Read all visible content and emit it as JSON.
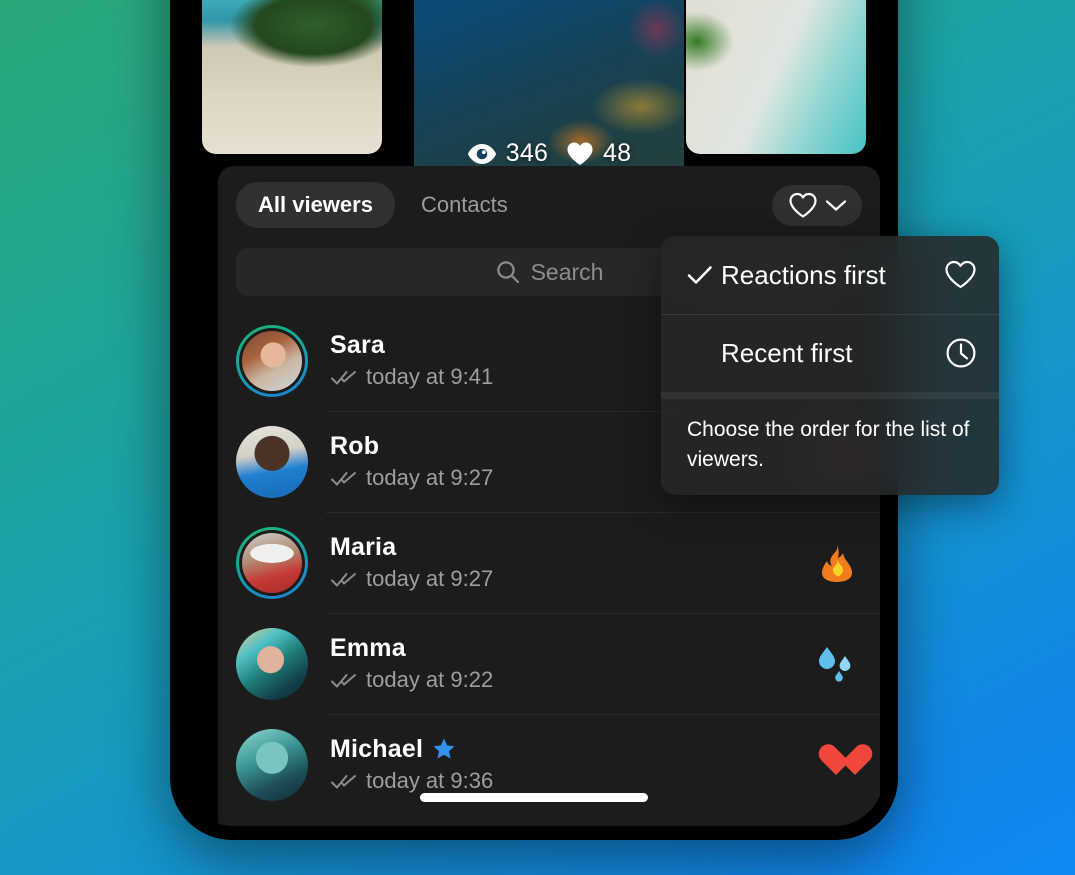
{
  "story": {
    "stats": [
      {
        "icon": "eye-icon",
        "label": "views",
        "value": "346"
      },
      {
        "icon": "heart-filled-icon",
        "label": "reactions",
        "value": "48"
      }
    ],
    "thumbnails": [
      {
        "name": "thumbnail-beach",
        "alt": "beach with palm tree"
      },
      {
        "name": "thumbnail-reef",
        "alt": "coral reef with diver"
      },
      {
        "name": "thumbnail-aerial",
        "alt": "aerial beach view"
      }
    ]
  },
  "panel": {
    "tabs": [
      {
        "label": "All viewers",
        "active": true
      },
      {
        "label": "Contacts",
        "active": false
      }
    ],
    "sort_button": {
      "icon": "heart-outline-icon",
      "chevron": "chevron-down-icon"
    },
    "search": {
      "placeholder": "Search",
      "value": "",
      "icon": "search-icon"
    },
    "viewers": [
      {
        "name": "Sara",
        "time": "today at 9:41",
        "status_icon": "double-check-icon",
        "reaction": "",
        "premium": false,
        "has_story_ring": true,
        "avatar": "av-sara"
      },
      {
        "name": "Rob",
        "time": "today at 9:27",
        "status_icon": "double-check-icon",
        "reaction": "heart",
        "premium": false,
        "has_story_ring": false,
        "avatar": "av-rob"
      },
      {
        "name": "Maria",
        "time": "today at 9:27",
        "status_icon": "double-check-icon",
        "reaction": "fire",
        "premium": false,
        "has_story_ring": true,
        "avatar": "av-maria"
      },
      {
        "name": "Emma",
        "time": "today at 9:22",
        "status_icon": "double-check-icon",
        "reaction": "droplets",
        "premium": false,
        "has_story_ring": false,
        "avatar": "av-emma"
      },
      {
        "name": "Michael",
        "time": "today at 9:36",
        "status_icon": "double-check-icon",
        "reaction": "heart",
        "premium": true,
        "has_story_ring": false,
        "avatar": "av-michael"
      }
    ]
  },
  "sort_menu": {
    "items": [
      {
        "label": "Reactions first",
        "checked": true,
        "icon": "heart-outline-icon"
      },
      {
        "label": "Recent first",
        "checked": false,
        "icon": "clock-icon"
      }
    ],
    "footer": "Choose the order for the list of viewers."
  },
  "colors": {
    "background_start": "#2aa87a",
    "background_end": "#0e88f5",
    "panel": "#1c1c1c",
    "accent_active_tab": "#303030",
    "heart_red": "#f0463c",
    "premium_star": "#3390ec",
    "story_ring_start": "#1fb36e",
    "story_ring_end": "#1d7fd6"
  }
}
